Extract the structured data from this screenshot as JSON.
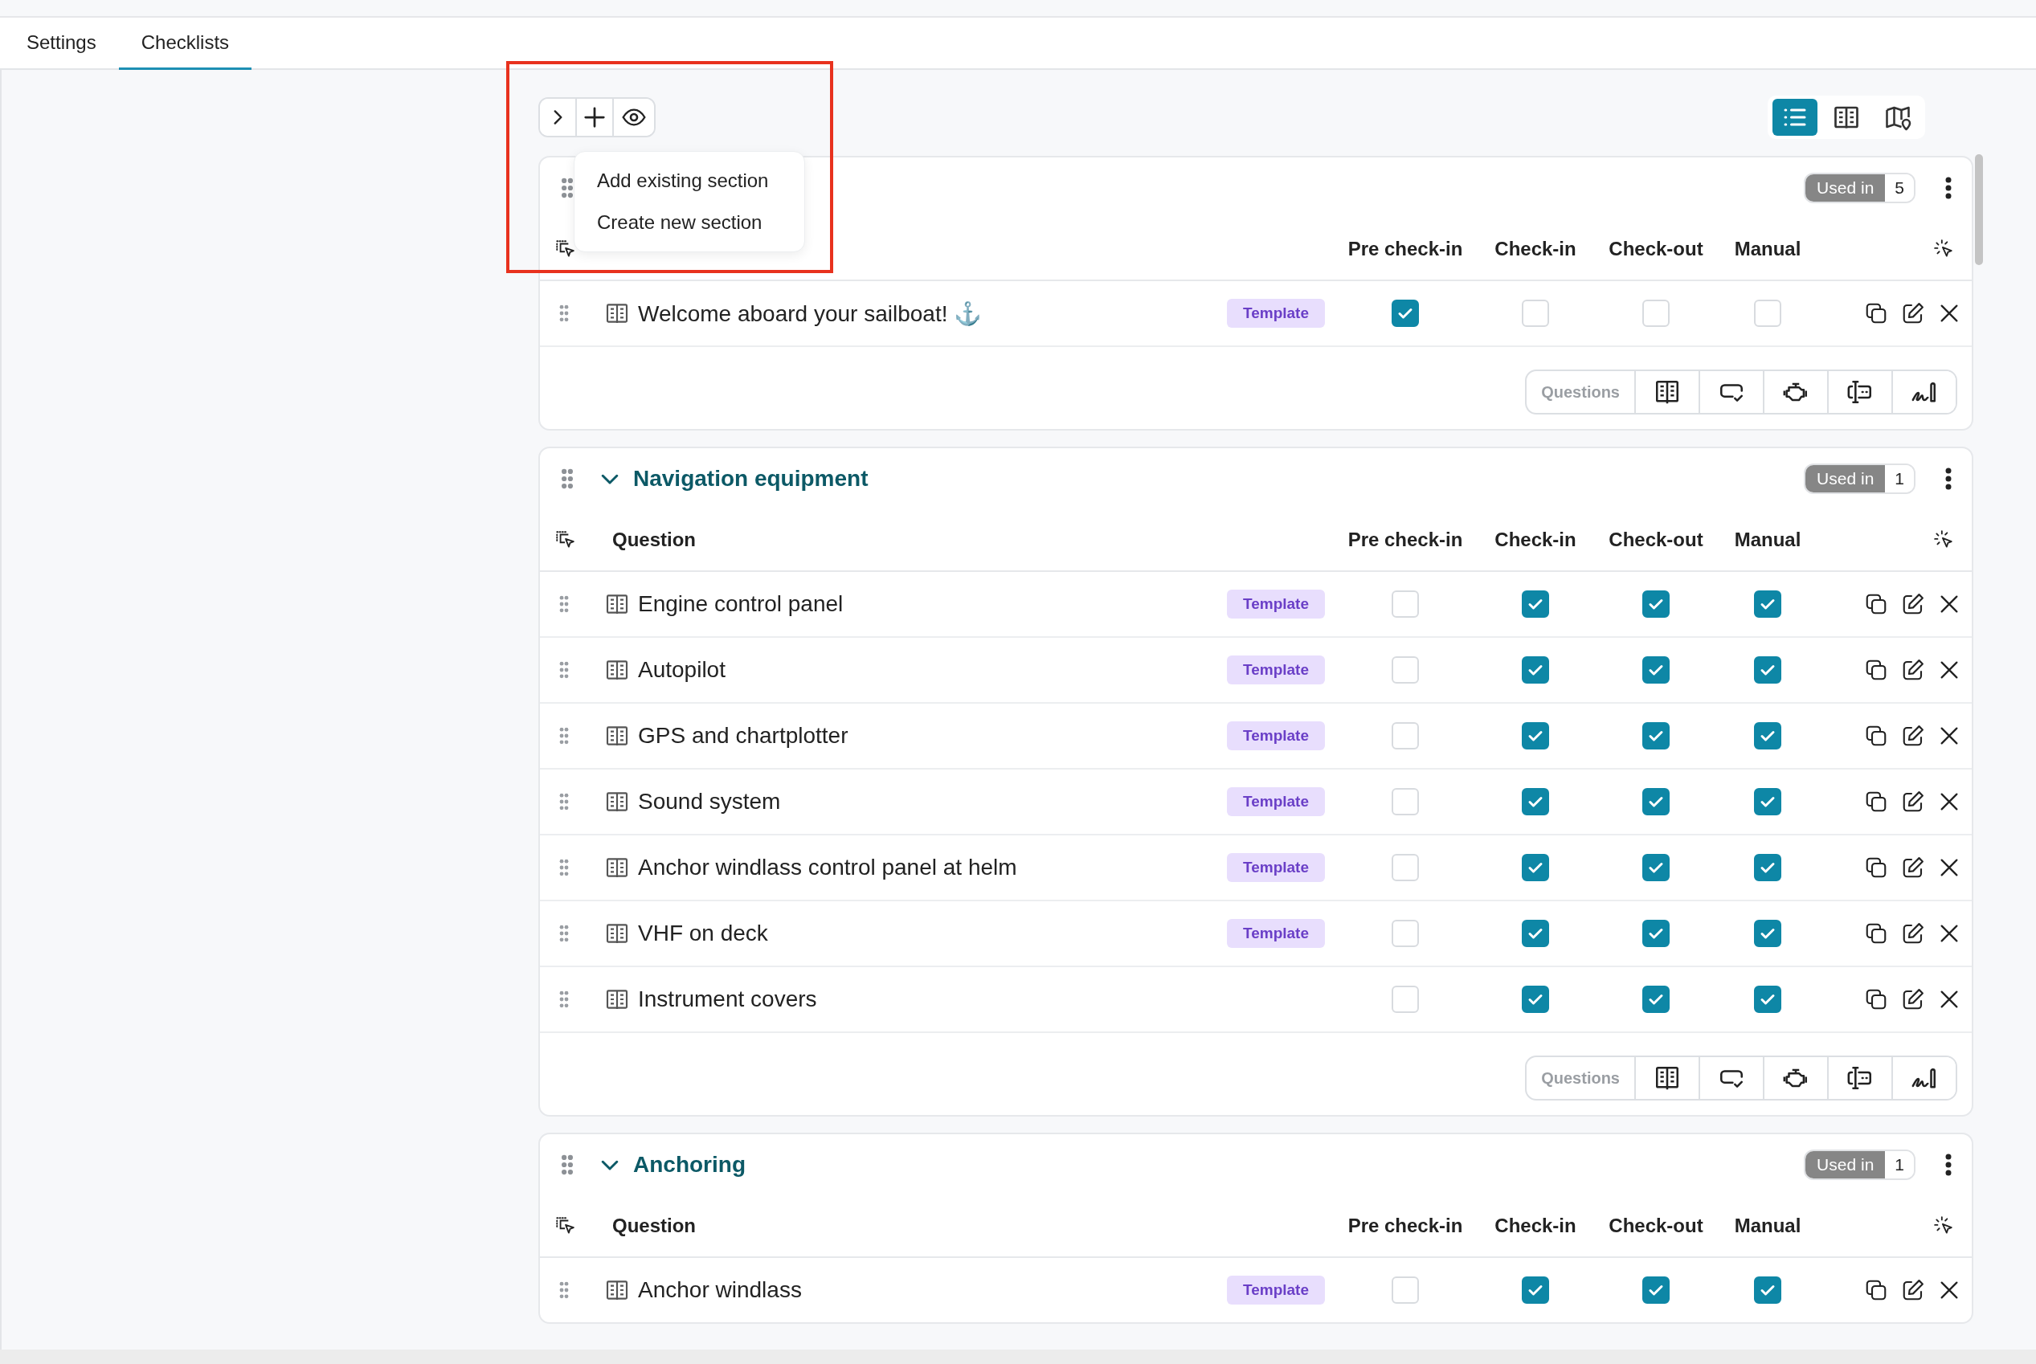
{
  "tabs": [
    {
      "label": "Settings",
      "selected": false
    },
    {
      "label": "Checklists",
      "selected": true
    }
  ],
  "view_modes": [
    {
      "kind": "list",
      "selected": true
    },
    {
      "kind": "book",
      "selected": false
    },
    {
      "kind": "map",
      "selected": false
    }
  ],
  "menu": {
    "items": [
      "Add existing section",
      "Create new section"
    ]
  },
  "question_types": [
    {
      "kind": "book"
    },
    {
      "kind": "comment-check"
    },
    {
      "kind": "engine"
    },
    {
      "kind": "text-box"
    },
    {
      "kind": "signature"
    }
  ],
  "sections": [
    {
      "used_in_label": "Used in",
      "used_in_count": "5",
      "columns": [
        "Pre check-in",
        "Check-in",
        "Check-out",
        "Manual"
      ],
      "toolbar_label": "Questions",
      "rows": [
        {
          "text": "Welcome aboard your sailboat! ⚓",
          "tag": "Template",
          "checks": [
            true,
            false,
            false,
            false
          ]
        }
      ]
    },
    {
      "title": "Navigation equipment",
      "used_in_label": "Used in",
      "used_in_count": "1",
      "question_header": "Question",
      "columns": [
        "Pre check-in",
        "Check-in",
        "Check-out",
        "Manual"
      ],
      "toolbar_label": "Questions",
      "rows": [
        {
          "text": "Engine control panel",
          "tag": "Template",
          "checks": [
            false,
            true,
            true,
            true
          ]
        },
        {
          "text": "Autopilot",
          "tag": "Template",
          "checks": [
            false,
            true,
            true,
            true
          ]
        },
        {
          "text": "GPS and chartplotter",
          "tag": "Template",
          "checks": [
            false,
            true,
            true,
            true
          ]
        },
        {
          "text": "Sound system",
          "tag": "Template",
          "checks": [
            false,
            true,
            true,
            true
          ]
        },
        {
          "text": "Anchor windlass control panel at helm",
          "tag": "Template",
          "checks": [
            false,
            true,
            true,
            true
          ]
        },
        {
          "text": "VHF on deck",
          "tag": "Template",
          "checks": [
            false,
            true,
            true,
            true
          ]
        },
        {
          "text": "Instrument covers",
          "checks": [
            false,
            true,
            true,
            true
          ]
        }
      ]
    },
    {
      "title": "Anchoring",
      "used_in_label": "Used in",
      "used_in_count": "1",
      "question_header": "Question",
      "columns": [
        "Pre check-in",
        "Check-in",
        "Check-out",
        "Manual"
      ],
      "rows": [
        {
          "text": "Anchor windlass",
          "tag": "Template",
          "checks": [
            false,
            true,
            true,
            true
          ]
        }
      ]
    }
  ]
}
